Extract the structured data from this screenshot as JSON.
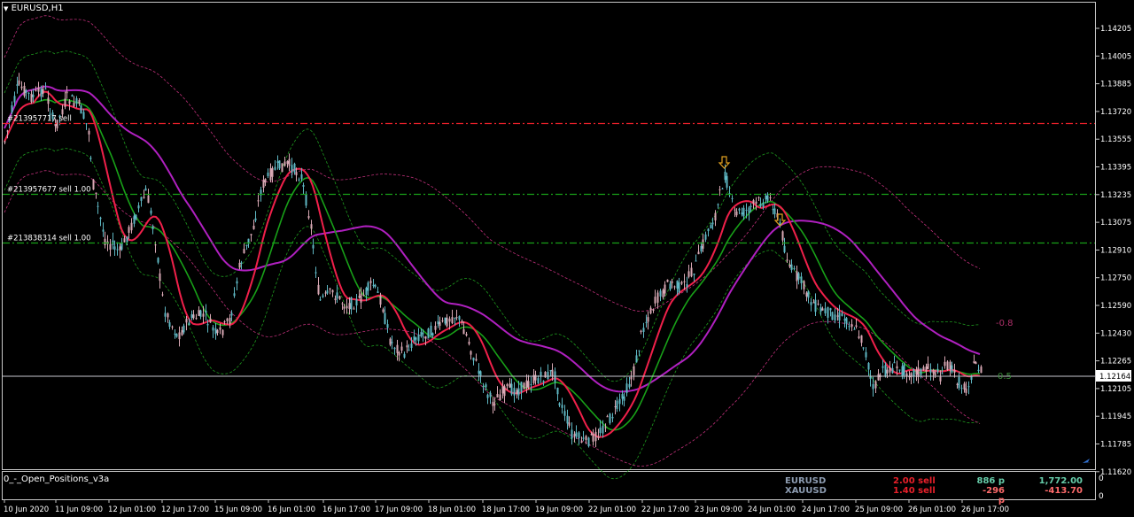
{
  "window": {
    "symbol_title": "EURUSD,H1",
    "menu_icon": "triangle-down-icon"
  },
  "price_axis": {
    "labels": [
      "1.14205",
      "1.14005",
      "1.13885",
      "1.13720",
      "1.13555",
      "1.13395",
      "1.13235",
      "1.13075",
      "1.12910",
      "1.12750",
      "1.12590",
      "1.12430",
      "1.12265",
      "1.12105",
      "1.11945",
      "1.11785",
      "1.11620"
    ],
    "current_price": "1.12164"
  },
  "time_axis": {
    "labels": [
      "10 Jun 2020",
      "11 Jun 09:00",
      "12 Jun 01:00",
      "12 Jun 17:00",
      "15 Jun 09:00",
      "16 Jun 01:00",
      "16 Jun 17:00",
      "17 Jun 09:00",
      "18 Jun 01:00",
      "18 Jun 17:00",
      "19 Jun 09:00",
      "22 Jun 01:00",
      "22 Jun 17:00",
      "23 Jun 09:00",
      "24 Jun 01:00",
      "24 Jun 17:00",
      "25 Jun 09:00",
      "26 Jun 01:00",
      "26 Jun 17:00"
    ]
  },
  "order_lines": [
    {
      "label": "#213957717 sell",
      "price": 1.13655,
      "color": "#e8202a"
    },
    {
      "label": "#213957677 sell 1.00",
      "price": 1.1324,
      "color": "#18a018"
    },
    {
      "label": "#213838314 sell 1.00",
      "price": 1.12955,
      "color": "#18a018"
    }
  ],
  "chart_labels": {
    "fib_upper": "-0.8",
    "fib_lower": "0.5"
  },
  "subwindow": {
    "title": "0_-_Open_Positions_v3a",
    "scale_top": "0",
    "scale_bottom": "0",
    "positions": [
      {
        "symbol": "EURUSD",
        "lots": "2.00 sell",
        "points": "886 p",
        "profit": "1,772.00",
        "points_color": "#66cdaa",
        "profit_color": "#66cdaa"
      },
      {
        "symbol": "XAUUSD",
        "lots": "1.40 sell",
        "points": "-296 p",
        "profit": "-413.70",
        "points_color": "#ff6b6b",
        "profit_color": "#ff6b6b"
      }
    ]
  },
  "colors": {
    "bull": "#5fb8c4",
    "bear": "#d8a8b4",
    "ma_fast": "#f0204a",
    "ma_mid": "#18a018",
    "ma_slow": "#b020c0",
    "band_green": "#1e9a1e",
    "band_pink": "#c0307a",
    "arrow": "#e0a020"
  }
}
